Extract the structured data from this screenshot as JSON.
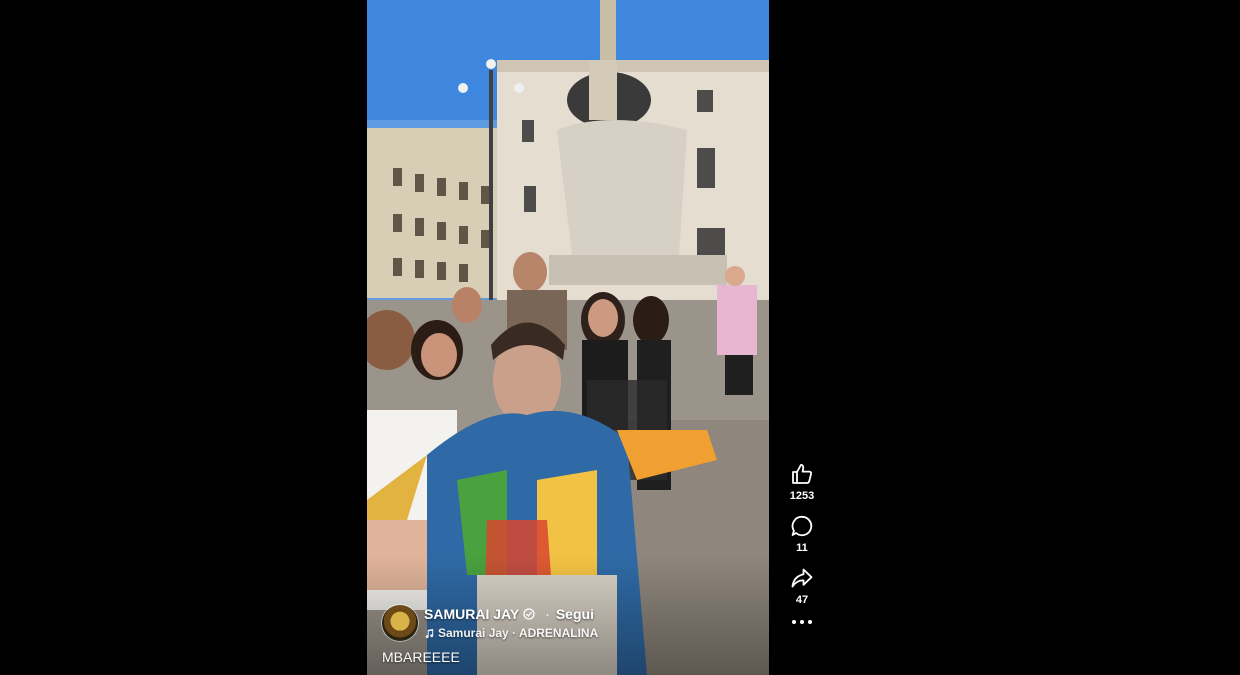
{
  "post": {
    "author": "SAMURAI JAY",
    "follow_separator": "·",
    "follow_label": "Segui",
    "music": "Samurai Jay · ADRENALINA",
    "caption": "MBAREEEE"
  },
  "actions": {
    "likes": "1253",
    "comments": "11",
    "shares": "47"
  },
  "icons": {
    "like": "thumbs-up-icon",
    "comment": "comment-bubble-icon",
    "share": "share-arrow-icon",
    "more": "more-dots-icon",
    "verified": "verified-badge-icon",
    "music": "music-note-icon"
  }
}
